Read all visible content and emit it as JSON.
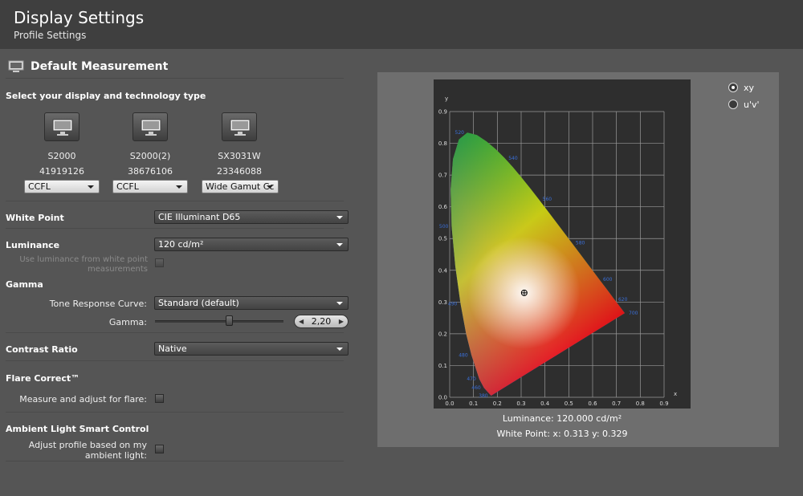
{
  "header": {
    "title": "Display Settings",
    "subtitle": "Profile Settings"
  },
  "section": {
    "title": "Default Measurement"
  },
  "display_select": {
    "label": "Select your display and technology type",
    "displays": [
      {
        "name": "S2000",
        "serial": "41919126",
        "tech": "CCFL"
      },
      {
        "name": "S2000(2)",
        "serial": "38676106",
        "tech": "CCFL"
      },
      {
        "name": "SX3031W",
        "serial": "23346088",
        "tech": "Wide Gamut Cc"
      }
    ]
  },
  "white_point": {
    "label": "White Point",
    "value": "CIE Illuminant D65"
  },
  "luminance": {
    "label": "Luminance",
    "value": "120 cd/m²",
    "option_label": "Use luminance from white point measurements"
  },
  "gamma": {
    "label": "Gamma",
    "trc_label": "Tone Response Curve:",
    "trc_value": "Standard (default)",
    "gamma_label": "Gamma:",
    "gamma_value": "2,20",
    "slider_fraction": 0.58
  },
  "contrast": {
    "label": "Contrast Ratio",
    "value": "Native"
  },
  "flare": {
    "label": "Flare Correct™",
    "option_label": "Measure and adjust for flare:"
  },
  "ambient": {
    "label": "Ambient Light Smart Control",
    "option_label": "Adjust profile based on my ambient light:"
  },
  "chart_options": {
    "xy_label": "xy",
    "uv_label": "u'v'",
    "selected": "xy"
  },
  "chart_info": {
    "luminance_text": "Luminance: 120.000 cd/m²",
    "white_point_text": "White Point: x: 0.313  y: 0.329"
  },
  "chart_data": {
    "type": "scatter",
    "xlabel": "x",
    "ylabel": "y",
    "xlim": [
      0,
      0.9
    ],
    "ylim": [
      0,
      0.9
    ],
    "x_ticks": [
      "0.0",
      "0.1",
      "0.2",
      "0.3",
      "0.4",
      "0.5",
      "0.6",
      "0.7",
      "0.8",
      "0.9"
    ],
    "y_ticks": [
      "0.0",
      "0.1",
      "0.2",
      "0.3",
      "0.4",
      "0.5",
      "0.6",
      "0.7",
      "0.8",
      "0.9"
    ],
    "grid": true,
    "white_point": {
      "x": 0.313,
      "y": 0.329
    },
    "wavelength_labels": [
      {
        "text": "520",
        "x": 0.074,
        "y": 0.834
      },
      {
        "text": "540",
        "x": 0.23,
        "y": 0.754
      },
      {
        "text": "560",
        "x": 0.373,
        "y": 0.624
      },
      {
        "text": "580",
        "x": 0.512,
        "y": 0.487
      },
      {
        "text": "600",
        "x": 0.627,
        "y": 0.372
      },
      {
        "text": "620",
        "x": 0.691,
        "y": 0.308
      },
      {
        "text": "700",
        "x": 0.735,
        "y": 0.265
      },
      {
        "text": "500",
        "x": 0.008,
        "y": 0.538
      },
      {
        "text": "490",
        "x": 0.045,
        "y": 0.295
      },
      {
        "text": "480",
        "x": 0.09,
        "y": 0.133
      },
      {
        "text": "470",
        "x": 0.124,
        "y": 0.058
      },
      {
        "text": "460",
        "x": 0.144,
        "y": 0.03
      },
      {
        "text": "380",
        "x": 0.174,
        "y": 0.005
      }
    ]
  },
  "colors": {
    "header": "#3f3f3f",
    "background": "#555555",
    "chart_panel": "#6e6e6e",
    "plot": "#2e2e2e"
  }
}
